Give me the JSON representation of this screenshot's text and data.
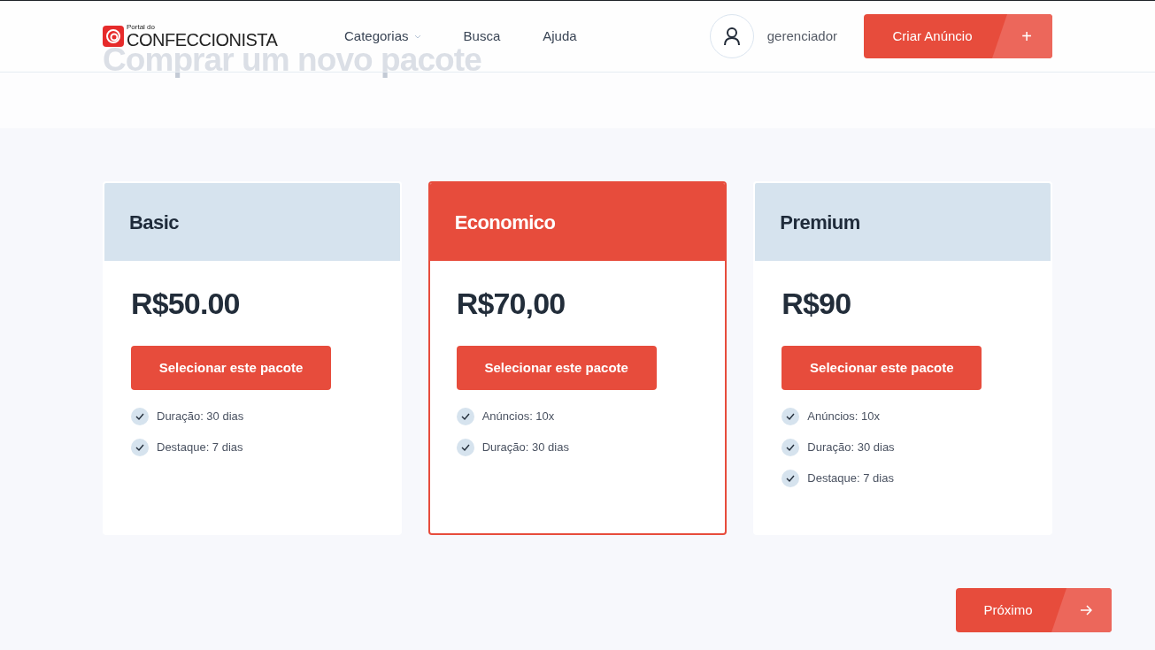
{
  "header": {
    "logo": {
      "small": "Portal do",
      "big": "CONFECCIONISTA"
    },
    "nav": [
      {
        "label": "Categorias",
        "dropdown": true
      },
      {
        "label": "Busca",
        "dropdown": false
      },
      {
        "label": "Ajuda",
        "dropdown": false
      }
    ],
    "user": "gerenciador",
    "create_button": {
      "label": "Criar Anúncio",
      "icon": "+"
    }
  },
  "page_title": "Comprar um novo pacote",
  "packages": [
    {
      "name": "Basic",
      "price": "R$50.00",
      "button": "Selecionar este pacote",
      "selected": false,
      "features": [
        "Duração: 30 dias",
        "Destaque: 7 dias"
      ]
    },
    {
      "name": "Economico",
      "price": "R$70,00",
      "button": "Selecionar este pacote",
      "selected": true,
      "features": [
        "Anúncios: 10x",
        "Duração: 30 dias"
      ]
    },
    {
      "name": "Premium",
      "price": "R$90",
      "button": "Selecionar este pacote",
      "selected": false,
      "features": [
        "Anúncios: 10x",
        "Duração: 30 dias",
        "Destaque: 7 dias"
      ]
    }
  ],
  "next_button": {
    "label": "Próximo"
  }
}
